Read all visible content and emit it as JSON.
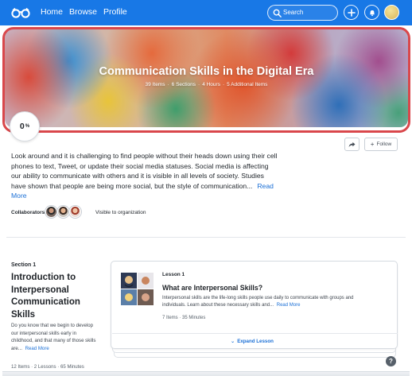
{
  "nav": {
    "links": [
      "Home",
      "Browse",
      "Profile"
    ],
    "search_placeholder": "Search",
    "brand_color": "#1878e6"
  },
  "hero": {
    "title": "Communication Skills in the Digital Era",
    "meta": [
      "39 Items",
      "6 Sections",
      "4 Hours",
      "5 Additional Items"
    ],
    "separator": "·",
    "highlight_color": "#d9474b"
  },
  "progress": {
    "value": "0",
    "unit": "%"
  },
  "actions": {
    "follow_label": "Follow"
  },
  "description": {
    "text": "Look around and it is challenging to find people without their heads down using their cell phones to text, Tweet, or update their social media statuses. Social media is affecting our ability to communicate with others and it is visible in all levels of society. Studies have shown that people are being more social, but the style of communication...",
    "read_more": "Read More"
  },
  "collaborators": {
    "label": "Collaborators:",
    "visibility": "Visible to organization"
  },
  "section": {
    "number": "Section 1",
    "title": "Introduction to Interpersonal Communication Skills",
    "description": "Do you know that we begin to develop our interpersonal skills early in childhood, and that many of those skills are...",
    "read_more": "Read More",
    "meta": [
      "12 Items",
      "2 Lessons",
      "65 Minutes"
    ]
  },
  "lesson": {
    "number": "Lesson 1",
    "title": "What are Interpersonal Skills?",
    "description": "Interpersonal skills are the life-long skills people use daily to communicate with groups and individuals. Learn about these necessary skills and...",
    "read_more": "Read More",
    "meta": [
      "7 Items",
      "35 Minutes"
    ],
    "expand_label": "Expand Lesson"
  },
  "help_label": "?"
}
